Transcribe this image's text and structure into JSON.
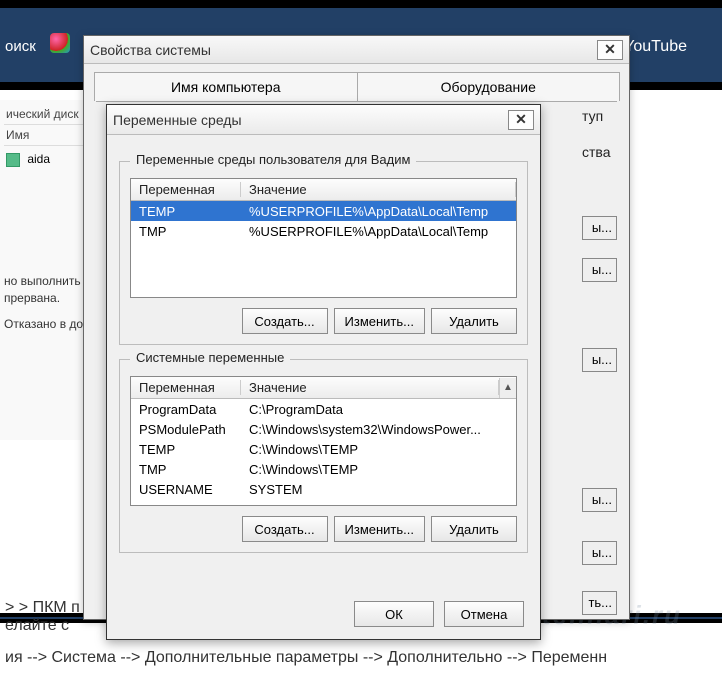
{
  "background": {
    "search_fragment": "оиск",
    "youtube": "YouTube",
    "left_panel": {
      "header1": "ический диск",
      "name_col": "Имя",
      "file_item": "aida",
      "msg_line1": "но выполнить фай",
      "msg_line2": "прервана.",
      "msg_line3": "Отказано в доступ"
    },
    "breadcrumb_upper": "> ПКМ п                                                                                          ть --> Доп",
    "breadcrumb_upper2": "елайте с",
    "breadcrumb_lower": "ия --> Система --> Дополнительные параметры --> Дополнительно --> Переменн",
    "watermark": "tehnari.ru"
  },
  "outer_window": {
    "title": "Свойства системы",
    "tabs": [
      "Имя компьютера",
      "Оборудование"
    ],
    "remnant_tab_text": "туп",
    "remnant_text": "ства",
    "remnant_btn": "ы...",
    "remnant_btn2": "ть..."
  },
  "inner_window": {
    "title": "Переменные среды",
    "user_group_label": "Переменные среды пользователя для Вадим",
    "sys_group_label": "Системные переменные",
    "col_name": "Переменная",
    "col_value": "Значение",
    "user_vars": [
      {
        "name": "TEMP",
        "value": "%USERPROFILE%\\AppData\\Local\\Temp",
        "selected": true
      },
      {
        "name": "TMP",
        "value": "%USERPROFILE%\\AppData\\Local\\Temp",
        "selected": false
      }
    ],
    "sys_vars": [
      {
        "name": "ProgramData",
        "value": "C:\\ProgramData"
      },
      {
        "name": "PSModulePath",
        "value": "C:\\Windows\\system32\\WindowsPower..."
      },
      {
        "name": "TEMP",
        "value": "C:\\Windows\\TEMP"
      },
      {
        "name": "TMP",
        "value": "C:\\Windows\\TEMP"
      },
      {
        "name": "USERNAME",
        "value": "SYSTEM"
      }
    ],
    "btn_create": "Создать...",
    "btn_edit": "Изменить...",
    "btn_delete": "Удалить",
    "btn_ok": "ОК",
    "btn_cancel": "Отмена"
  }
}
